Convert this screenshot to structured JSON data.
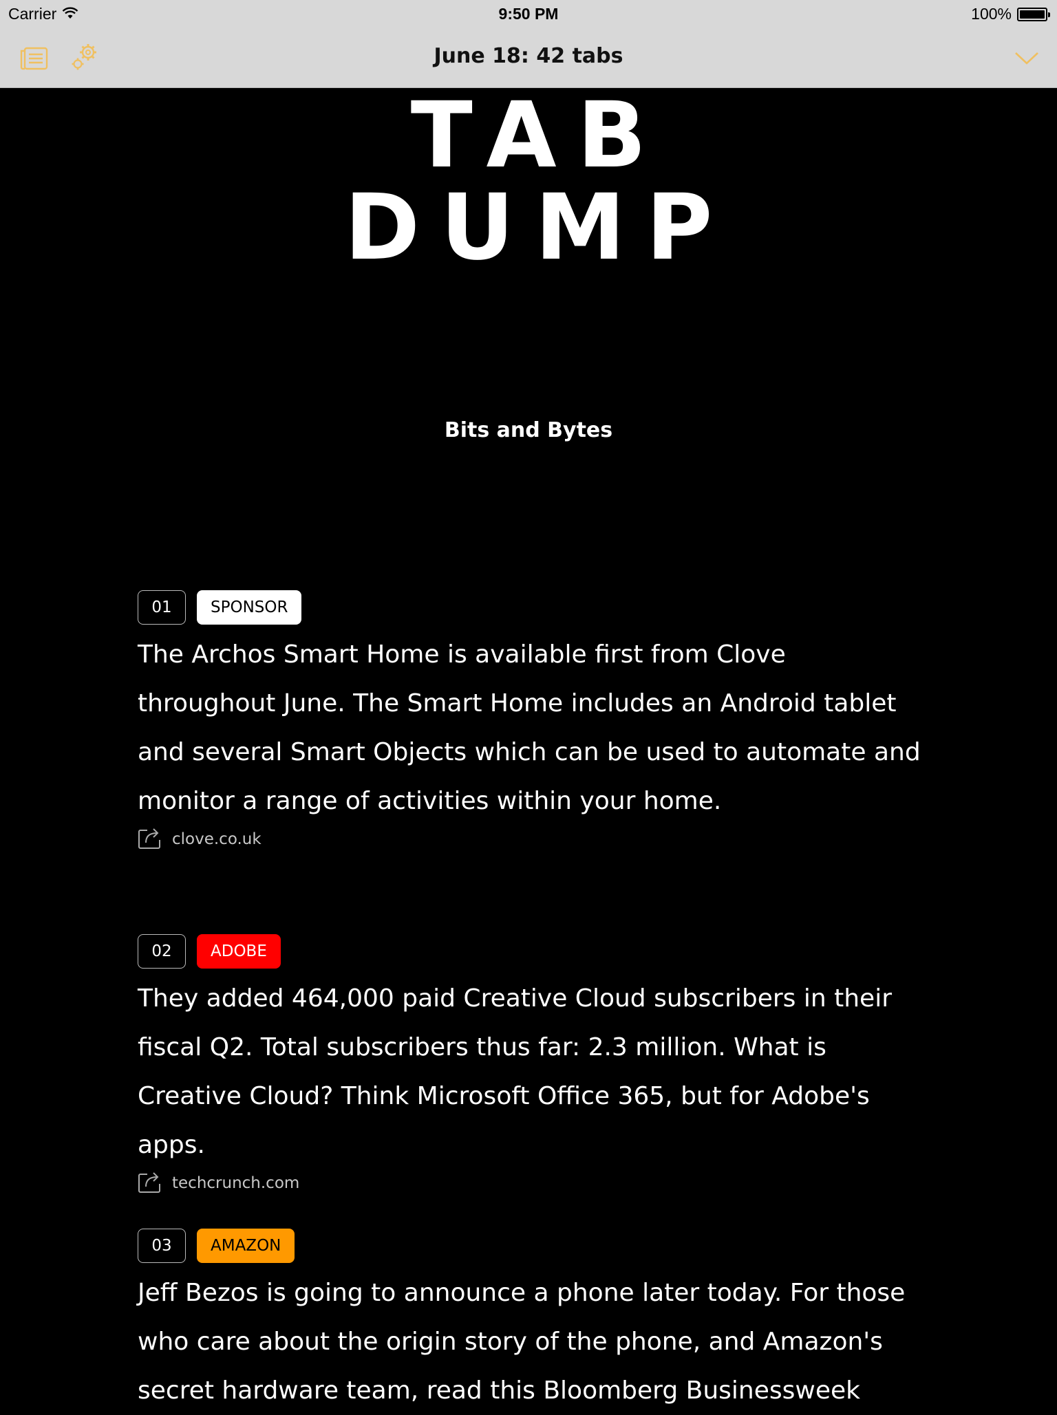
{
  "status_bar": {
    "carrier": "Carrier",
    "time": "9:50 PM",
    "battery": "100%"
  },
  "nav": {
    "title": "June 18: 42 tabs",
    "accent_color": "#f0c060",
    "left_icons": [
      "list-icon",
      "gears-icon"
    ],
    "right_icon": "chevron-down-icon"
  },
  "masthead": {
    "line1": "TAB",
    "line2": "DUMP"
  },
  "section": {
    "heading": "Bits and Bytes"
  },
  "items": [
    {
      "number": "01",
      "tag": "SPONSOR",
      "tag_color": "#ffffff",
      "text": "The Archos Smart Home is available first from Clove throughout June. The Smart Home includes an Android tablet and several Smart Objects which can be used to automate and monitor a range of activities within your home.",
      "link": "clove.co.uk"
    },
    {
      "number": "02",
      "tag": "ADOBE",
      "tag_color": "#ff0000",
      "text": "They added 464,000 paid Creative Cloud subscribers in their fiscal Q2. Total subscribers thus far: 2.3 million. What is Creative Cloud? Think Microsoft Office 365, but for Adobe's apps.",
      "link": "techcrunch.com"
    },
    {
      "number": "03",
      "tag": "AMAZON",
      "tag_color": "#ff9900",
      "text": "Jeff Bezos is going to announce a phone later today. For those who care about the origin story of the phone, and Amazon's secret hardware team, read this Bloomberg Businessweek"
    }
  ]
}
